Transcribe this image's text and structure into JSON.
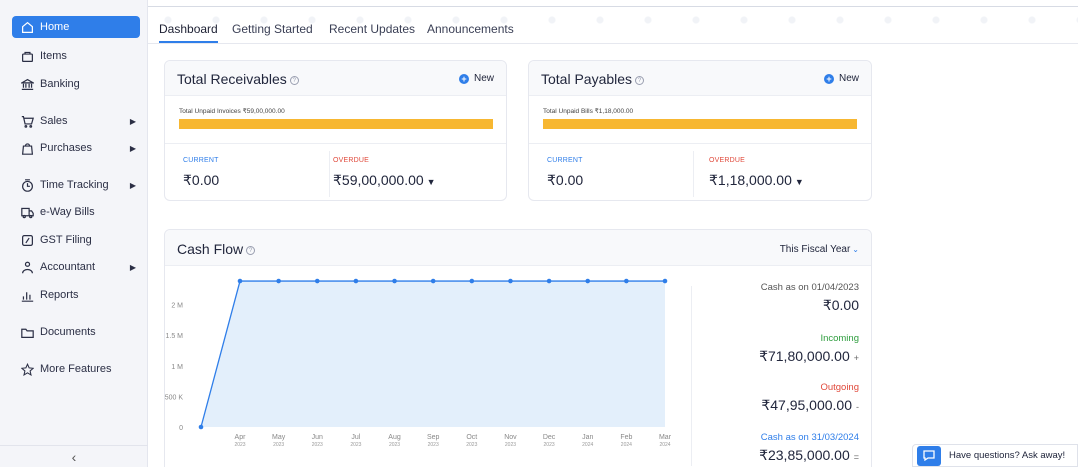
{
  "sidebar": {
    "items": [
      {
        "label": "Home",
        "icon": "home-icon"
      },
      {
        "label": "Items",
        "icon": "items-icon"
      },
      {
        "label": "Banking",
        "icon": "bank-icon"
      },
      {
        "label": "Sales",
        "icon": "cart-icon"
      },
      {
        "label": "Purchases",
        "icon": "bag-icon"
      },
      {
        "label": "Time Tracking",
        "icon": "clock-icon"
      },
      {
        "label": "e-Way Bills",
        "icon": "truck-icon"
      },
      {
        "label": "GST Filing",
        "icon": "gst-icon"
      },
      {
        "label": "Accountant",
        "icon": "user-icon"
      },
      {
        "label": "Reports",
        "icon": "reports-icon"
      },
      {
        "label": "Documents",
        "icon": "folder-icon"
      },
      {
        "label": "More Features",
        "icon": "star-icon"
      }
    ],
    "collapse_glyph": "‹"
  },
  "tabs": [
    {
      "label": "Dashboard"
    },
    {
      "label": "Getting Started"
    },
    {
      "label": "Recent Updates"
    },
    {
      "label": "Announcements"
    }
  ],
  "receivables": {
    "title": "Total Receivables",
    "new_label": "New",
    "unpaid": "Total Unpaid Invoices ₹59,00,000.00",
    "current_label": "CURRENT",
    "current_amount": "₹0.00",
    "overdue_label": "OVERDUE",
    "overdue_amount": "₹59,00,000.00",
    "overdue_fraction": 1.0
  },
  "payables": {
    "title": "Total Payables",
    "new_label": "New",
    "unpaid": "Total Unpaid Bills ₹1,18,000.00",
    "current_label": "CURRENT",
    "current_amount": "₹0.00",
    "overdue_label": "OVERDUE",
    "overdue_amount": "₹1,18,000.00",
    "overdue_fraction": 1.0
  },
  "cashflow": {
    "title": "Cash Flow",
    "period": "This Fiscal Year",
    "opening_label": "Cash as on 01/04/2023",
    "opening_value": "₹0.00",
    "incoming_label": "Incoming",
    "incoming_value": "₹71,80,000.00",
    "incoming_op": "+",
    "outgoing_label": "Outgoing",
    "outgoing_value": "₹47,95,000.00",
    "outgoing_op": "-",
    "closing_label": "Cash as on 31/03/2024",
    "closing_value": "₹23,85,000.00",
    "closing_op": "="
  },
  "chat": {
    "label": "Have questions? Ask away!"
  },
  "colors": {
    "accent": "#2f7ee9",
    "bar": "#f7b731",
    "overdue": "#e0493b",
    "incoming": "#2e9d3e"
  },
  "chart_data": {
    "type": "area",
    "y_ticks": [
      "0",
      "500 K",
      "1 M",
      "1.5 M",
      "2 M"
    ],
    "ylim": [
      0,
      2500000
    ],
    "tick_values": [
      0,
      500000,
      1000000,
      1500000,
      2000000
    ],
    "x_months": [
      "Apr",
      "May",
      "Jun",
      "Jul",
      "Aug",
      "Sep",
      "Oct",
      "Nov",
      "Dec",
      "Jan",
      "Feb",
      "Mar"
    ],
    "x_years": [
      "2023",
      "2023",
      "2023",
      "2023",
      "2023",
      "2023",
      "2023",
      "2023",
      "2023",
      "2024",
      "2024",
      "2024"
    ],
    "start_value": 0,
    "values": [
      2385000,
      2385000,
      2385000,
      2385000,
      2385000,
      2385000,
      2385000,
      2385000,
      2385000,
      2385000,
      2385000,
      2385000
    ],
    "grid": false
  }
}
